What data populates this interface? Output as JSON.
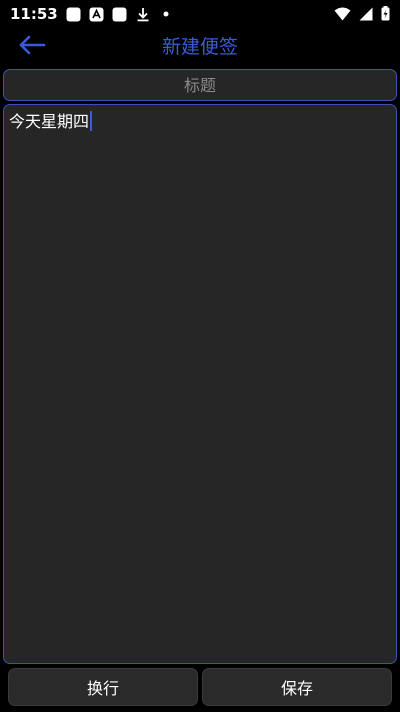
{
  "status_bar": {
    "time": "11:53",
    "icons": [
      "square-notification-icon",
      "a-notification-icon",
      "square-notification-icon",
      "download-icon",
      "dot-icon",
      "wifi-icon",
      "signal-icon",
      "battery-icon"
    ]
  },
  "app_bar": {
    "title": "新建便签",
    "back_icon": "arrow-left-icon",
    "accent_color": "#3a5bd9"
  },
  "form": {
    "title_placeholder": "标题",
    "title_value": "",
    "content_value": "今天星期四"
  },
  "buttons": {
    "newline_label": "换行",
    "save_label": "保存"
  },
  "colors": {
    "background": "#000000",
    "field_background": "#262626",
    "field_border": "#3a52b8"
  }
}
